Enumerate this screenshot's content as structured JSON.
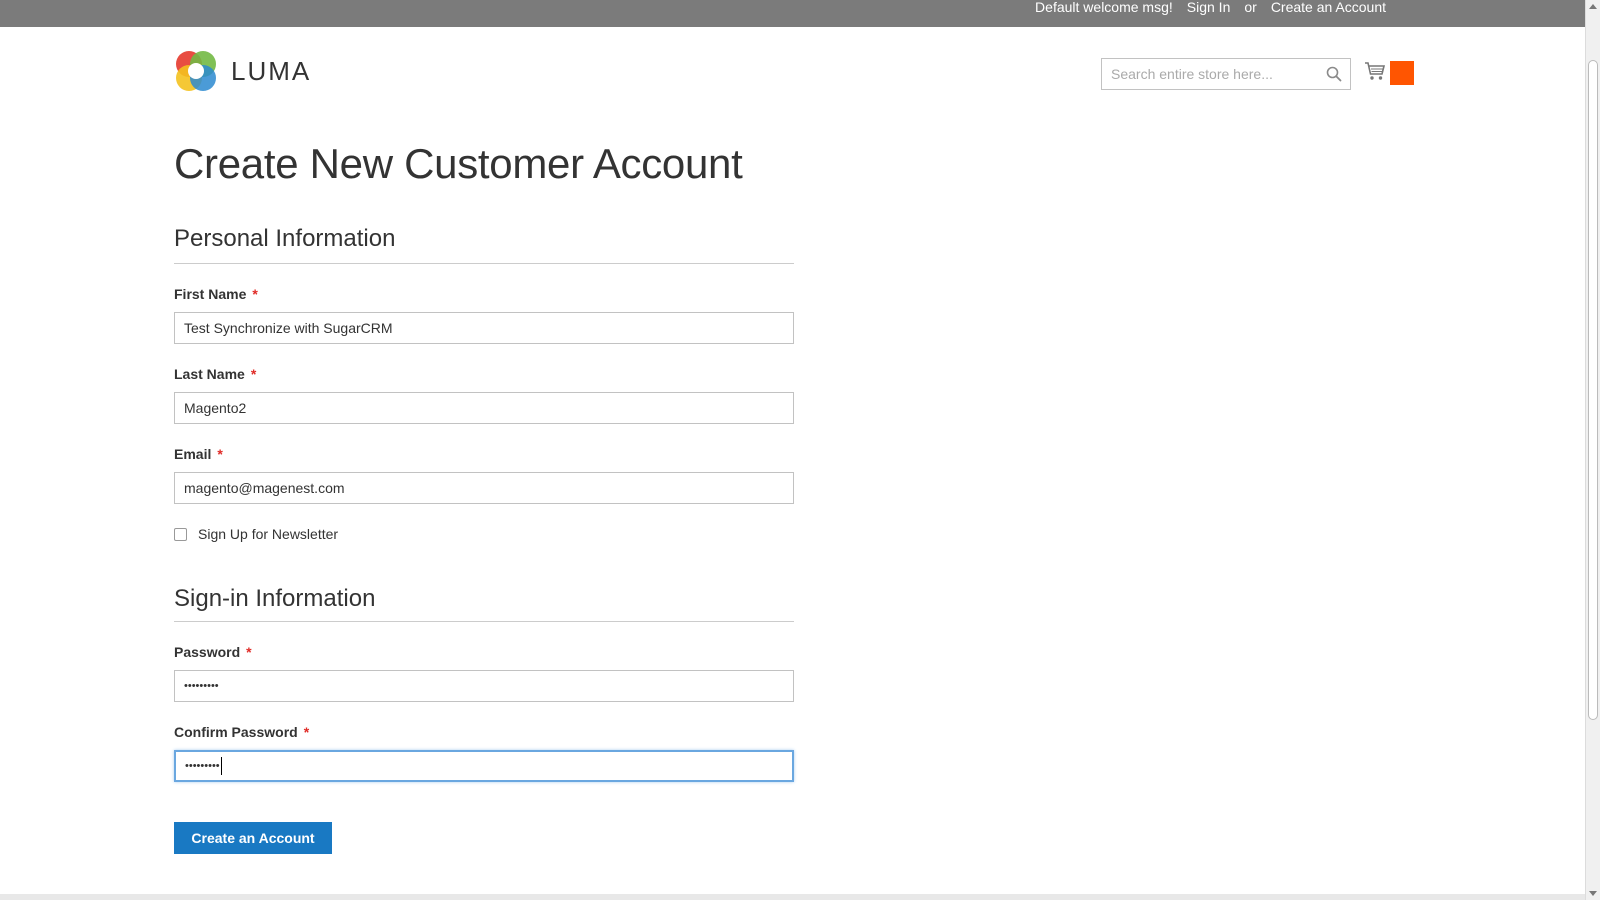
{
  "topbar": {
    "welcome": "Default welcome msg!",
    "sign_in": "Sign In",
    "or": "or",
    "create_account": "Create an Account"
  },
  "logo": {
    "text": "LUMA"
  },
  "search": {
    "placeholder": "Search entire store here..."
  },
  "cart": {
    "icon": "cart-icon",
    "badge_color": "#ff5501"
  },
  "page": {
    "title": "Create New Customer Account"
  },
  "personal": {
    "title": "Personal Information",
    "first_name_label": "First Name",
    "first_name_value": "Test Synchronize with SugarCRM",
    "last_name_label": "Last Name",
    "last_name_value": "Magento2",
    "email_label": "Email",
    "email_value": "magento@magenest.com",
    "newsletter_label": "Sign Up for Newsletter",
    "required_mark": "*"
  },
  "signin": {
    "title": "Sign-in Information",
    "password_label": "Password",
    "password_value": "•••••••••",
    "confirm_label": "Confirm Password",
    "confirm_value": "•••••••••"
  },
  "actions": {
    "create_button": "Create an Account"
  },
  "colors": {
    "topbar": "#7b7b7b",
    "primary_button": "#1979c3",
    "required": "#e02b27",
    "focus": "#6aa7e0"
  }
}
